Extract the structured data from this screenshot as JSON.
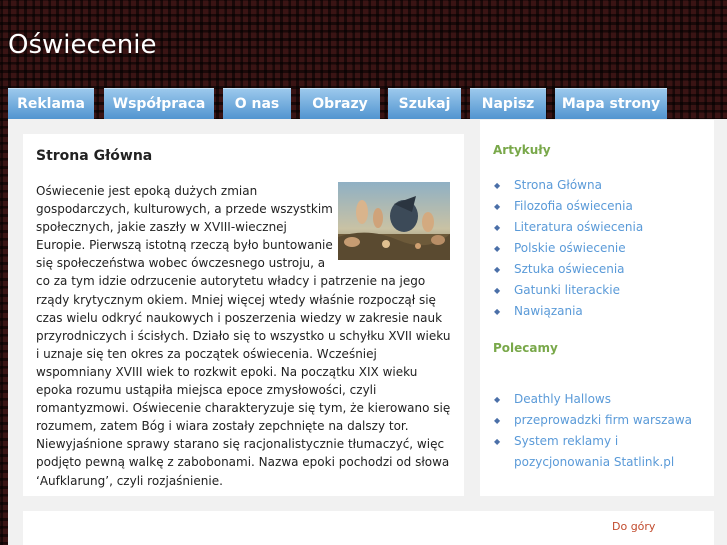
{
  "site": {
    "title": "Oświecenie"
  },
  "nav": {
    "items": [
      {
        "label": "Reklama"
      },
      {
        "label": "Współpraca"
      },
      {
        "label": "O nas"
      },
      {
        "label": "Obrazy"
      },
      {
        "label": "Szukaj"
      },
      {
        "label": "Napisz"
      },
      {
        "label": "Mapa strony"
      }
    ]
  },
  "main": {
    "heading": "Strona Główna",
    "image_icon": "painting-thumbnail",
    "body": "Oświecenie jest epoką dużych zmian gospodarczych, kulturowych, a przede wszystkim społecznych, jakie zaszły w XVIII-wiecznej Europie. Pierwszą istotną rzeczą było buntowanie się społeczeństwa wobec ówczesnego ustroju, a co za tym idzie odrzucenie autorytetu władcy i patrzenie na jego rządy krytycznym okiem. Mniej więcej wtedy właśnie rozpoczął się czas wielu odkryć naukowych i poszerzenia wiedzy w zakresie nauk przyrodniczych i ścisłych. Działo się to wszystko u schyłku XVII wieku i uznaje się ten okres za początek oświecenia. Wcześniej wspomniany XVIII wiek to rozkwit epoki. Na początku XIX wieku epoka rozumu ustąpiła miejsca epoce zmysłowości, czyli romantyzmowi. Oświecenie charakteryzuje się tym, że kierowano się rozumem, zatem Bóg i wiara zostały zepchnięte na dalszy tor. Niewyjaśnione sprawy starano się racjonalistycznie tłumaczyć, więc podjęto pewną walkę z zabobonami. Nazwa epoki pochodzi od słowa ‘Aufklarung’, czyli rozjaśnienie."
  },
  "sidebar": {
    "articles_heading": "Artykuły",
    "articles": [
      {
        "label": "Strona Główna"
      },
      {
        "label": "Filozofia oświecenia"
      },
      {
        "label": "Literatura oświecenia"
      },
      {
        "label": "Polskie oświecenie"
      },
      {
        "label": "Sztuka oświecenia"
      },
      {
        "label": "Gatunki literackie"
      },
      {
        "label": "Nawiązania"
      }
    ],
    "recommended_heading": "Polecamy",
    "recommended": [
      {
        "label": "Deathly Hallows"
      },
      {
        "label": "przeprowadzki firm warszawa"
      },
      {
        "label": "System reklamy i pozycjonowania Statlink.pl"
      }
    ],
    "bullet": "◆"
  },
  "footer": {
    "top_link": "Do góry"
  },
  "colors": {
    "nav_gradient_top": "#9bc8ec",
    "nav_gradient_bottom": "#4f93cf",
    "sidebar_heading": "#79a84a",
    "link": "#5a9ad8",
    "footer_link": "#c14a2c"
  }
}
